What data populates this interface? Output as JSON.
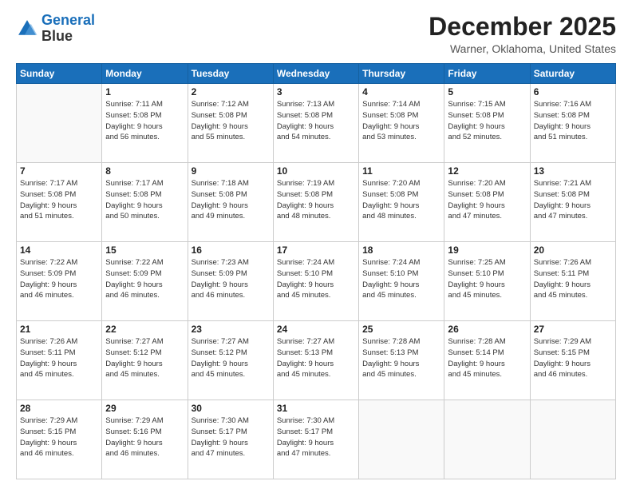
{
  "logo": {
    "line1": "General",
    "line2": "Blue"
  },
  "title": "December 2025",
  "subtitle": "Warner, Oklahoma, United States",
  "weekdays": [
    "Sunday",
    "Monday",
    "Tuesday",
    "Wednesday",
    "Thursday",
    "Friday",
    "Saturday"
  ],
  "weeks": [
    [
      {
        "day": "",
        "info": ""
      },
      {
        "day": "1",
        "info": "Sunrise: 7:11 AM\nSunset: 5:08 PM\nDaylight: 9 hours\nand 56 minutes."
      },
      {
        "day": "2",
        "info": "Sunrise: 7:12 AM\nSunset: 5:08 PM\nDaylight: 9 hours\nand 55 minutes."
      },
      {
        "day": "3",
        "info": "Sunrise: 7:13 AM\nSunset: 5:08 PM\nDaylight: 9 hours\nand 54 minutes."
      },
      {
        "day": "4",
        "info": "Sunrise: 7:14 AM\nSunset: 5:08 PM\nDaylight: 9 hours\nand 53 minutes."
      },
      {
        "day": "5",
        "info": "Sunrise: 7:15 AM\nSunset: 5:08 PM\nDaylight: 9 hours\nand 52 minutes."
      },
      {
        "day": "6",
        "info": "Sunrise: 7:16 AM\nSunset: 5:08 PM\nDaylight: 9 hours\nand 51 minutes."
      }
    ],
    [
      {
        "day": "7",
        "info": "Sunrise: 7:17 AM\nSunset: 5:08 PM\nDaylight: 9 hours\nand 51 minutes."
      },
      {
        "day": "8",
        "info": "Sunrise: 7:17 AM\nSunset: 5:08 PM\nDaylight: 9 hours\nand 50 minutes."
      },
      {
        "day": "9",
        "info": "Sunrise: 7:18 AM\nSunset: 5:08 PM\nDaylight: 9 hours\nand 49 minutes."
      },
      {
        "day": "10",
        "info": "Sunrise: 7:19 AM\nSunset: 5:08 PM\nDaylight: 9 hours\nand 48 minutes."
      },
      {
        "day": "11",
        "info": "Sunrise: 7:20 AM\nSunset: 5:08 PM\nDaylight: 9 hours\nand 48 minutes."
      },
      {
        "day": "12",
        "info": "Sunrise: 7:20 AM\nSunset: 5:08 PM\nDaylight: 9 hours\nand 47 minutes."
      },
      {
        "day": "13",
        "info": "Sunrise: 7:21 AM\nSunset: 5:08 PM\nDaylight: 9 hours\nand 47 minutes."
      }
    ],
    [
      {
        "day": "14",
        "info": "Sunrise: 7:22 AM\nSunset: 5:09 PM\nDaylight: 9 hours\nand 46 minutes."
      },
      {
        "day": "15",
        "info": "Sunrise: 7:22 AM\nSunset: 5:09 PM\nDaylight: 9 hours\nand 46 minutes."
      },
      {
        "day": "16",
        "info": "Sunrise: 7:23 AM\nSunset: 5:09 PM\nDaylight: 9 hours\nand 46 minutes."
      },
      {
        "day": "17",
        "info": "Sunrise: 7:24 AM\nSunset: 5:10 PM\nDaylight: 9 hours\nand 45 minutes."
      },
      {
        "day": "18",
        "info": "Sunrise: 7:24 AM\nSunset: 5:10 PM\nDaylight: 9 hours\nand 45 minutes."
      },
      {
        "day": "19",
        "info": "Sunrise: 7:25 AM\nSunset: 5:10 PM\nDaylight: 9 hours\nand 45 minutes."
      },
      {
        "day": "20",
        "info": "Sunrise: 7:26 AM\nSunset: 5:11 PM\nDaylight: 9 hours\nand 45 minutes."
      }
    ],
    [
      {
        "day": "21",
        "info": "Sunrise: 7:26 AM\nSunset: 5:11 PM\nDaylight: 9 hours\nand 45 minutes."
      },
      {
        "day": "22",
        "info": "Sunrise: 7:27 AM\nSunset: 5:12 PM\nDaylight: 9 hours\nand 45 minutes."
      },
      {
        "day": "23",
        "info": "Sunrise: 7:27 AM\nSunset: 5:12 PM\nDaylight: 9 hours\nand 45 minutes."
      },
      {
        "day": "24",
        "info": "Sunrise: 7:27 AM\nSunset: 5:13 PM\nDaylight: 9 hours\nand 45 minutes."
      },
      {
        "day": "25",
        "info": "Sunrise: 7:28 AM\nSunset: 5:13 PM\nDaylight: 9 hours\nand 45 minutes."
      },
      {
        "day": "26",
        "info": "Sunrise: 7:28 AM\nSunset: 5:14 PM\nDaylight: 9 hours\nand 45 minutes."
      },
      {
        "day": "27",
        "info": "Sunrise: 7:29 AM\nSunset: 5:15 PM\nDaylight: 9 hours\nand 46 minutes."
      }
    ],
    [
      {
        "day": "28",
        "info": "Sunrise: 7:29 AM\nSunset: 5:15 PM\nDaylight: 9 hours\nand 46 minutes."
      },
      {
        "day": "29",
        "info": "Sunrise: 7:29 AM\nSunset: 5:16 PM\nDaylight: 9 hours\nand 46 minutes."
      },
      {
        "day": "30",
        "info": "Sunrise: 7:30 AM\nSunset: 5:17 PM\nDaylight: 9 hours\nand 47 minutes."
      },
      {
        "day": "31",
        "info": "Sunrise: 7:30 AM\nSunset: 5:17 PM\nDaylight: 9 hours\nand 47 minutes."
      },
      {
        "day": "",
        "info": ""
      },
      {
        "day": "",
        "info": ""
      },
      {
        "day": "",
        "info": ""
      }
    ]
  ]
}
